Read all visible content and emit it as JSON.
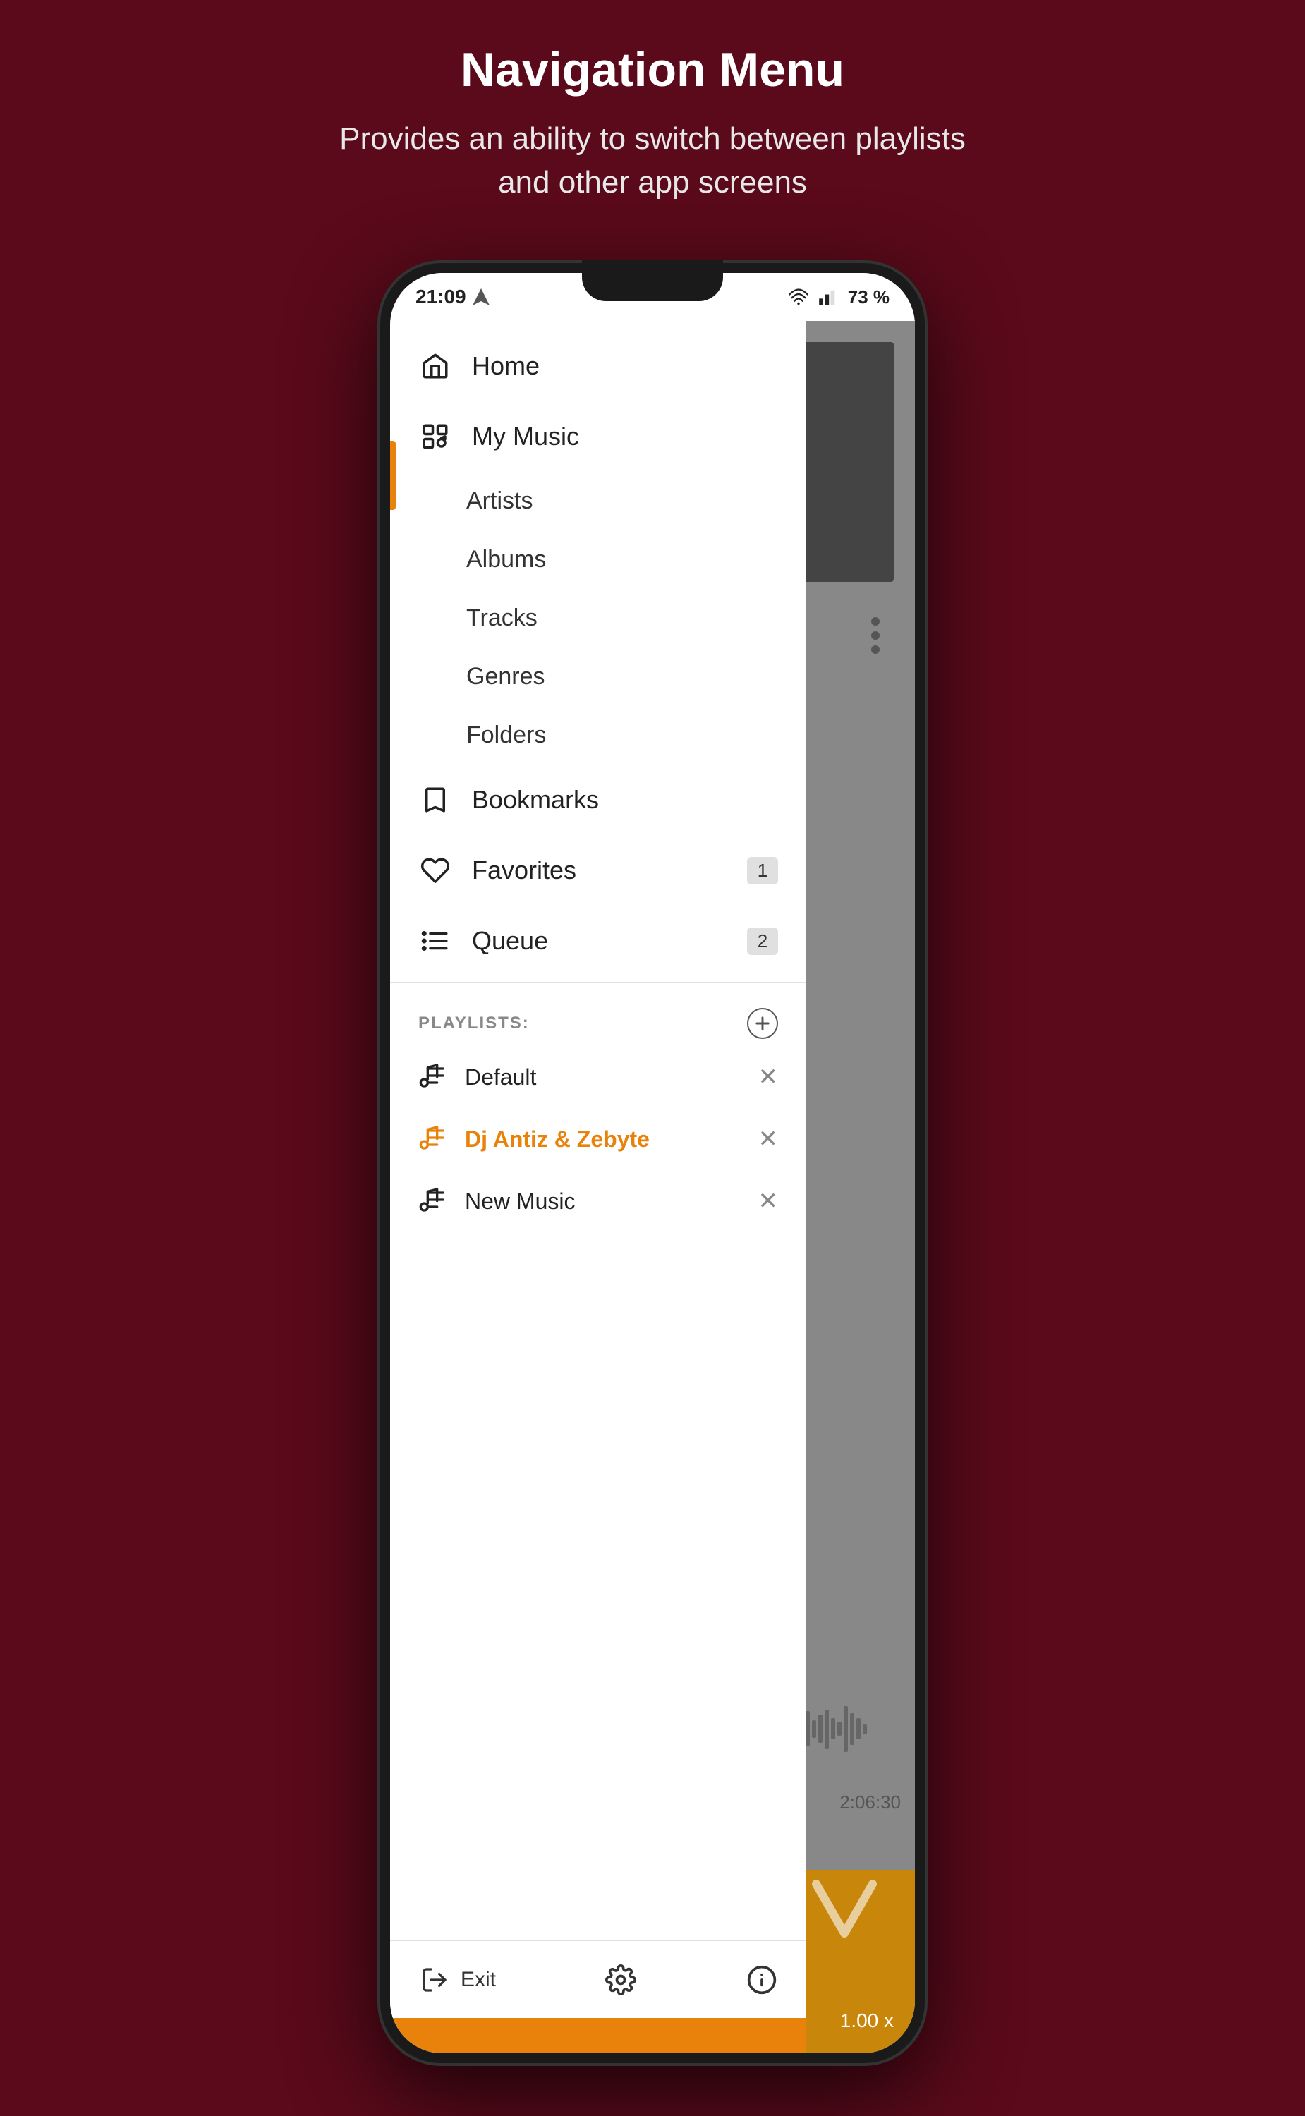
{
  "header": {
    "title": "Navigation Menu",
    "subtitle": "Provides an ability to switch between playlists and other app screens"
  },
  "status_bar": {
    "time": "21:09",
    "battery": "73 %"
  },
  "nav_menu": {
    "items": [
      {
        "id": "home",
        "label": "Home",
        "icon": "home-icon",
        "badge": null
      },
      {
        "id": "my-music",
        "label": "My Music",
        "icon": "music-library-icon",
        "badge": null
      },
      {
        "id": "bookmarks",
        "label": "Bookmarks",
        "icon": "bookmark-icon",
        "badge": null
      },
      {
        "id": "favorites",
        "label": "Favorites",
        "icon": "heart-icon",
        "badge": "1"
      },
      {
        "id": "queue",
        "label": "Queue",
        "icon": "queue-icon",
        "badge": "2"
      }
    ],
    "sub_items": [
      {
        "id": "artists",
        "label": "Artists"
      },
      {
        "id": "albums",
        "label": "Albums"
      },
      {
        "id": "tracks",
        "label": "Tracks"
      },
      {
        "id": "genres",
        "label": "Genres"
      },
      {
        "id": "folders",
        "label": "Folders"
      }
    ]
  },
  "playlists": {
    "label": "PLAYLISTS:",
    "add_label": "+",
    "items": [
      {
        "id": "default",
        "label": "Default",
        "active": false
      },
      {
        "id": "dj-antiz",
        "label": "Dj Antiz & Zebyte",
        "active": true
      },
      {
        "id": "new-music",
        "label": "New Music",
        "active": false
      }
    ]
  },
  "bottom_bar": {
    "exit_label": "Exit",
    "exit_icon": "exit-icon",
    "settings_icon": "settings-icon",
    "info_icon": "info-icon"
  },
  "bg_content": {
    "time_display": "2:06:30",
    "speed_label": "1.00 x"
  },
  "colors": {
    "accent": "#e8820a",
    "dark_bg": "#5a0a1a",
    "active_indicator": "#e8820a"
  }
}
